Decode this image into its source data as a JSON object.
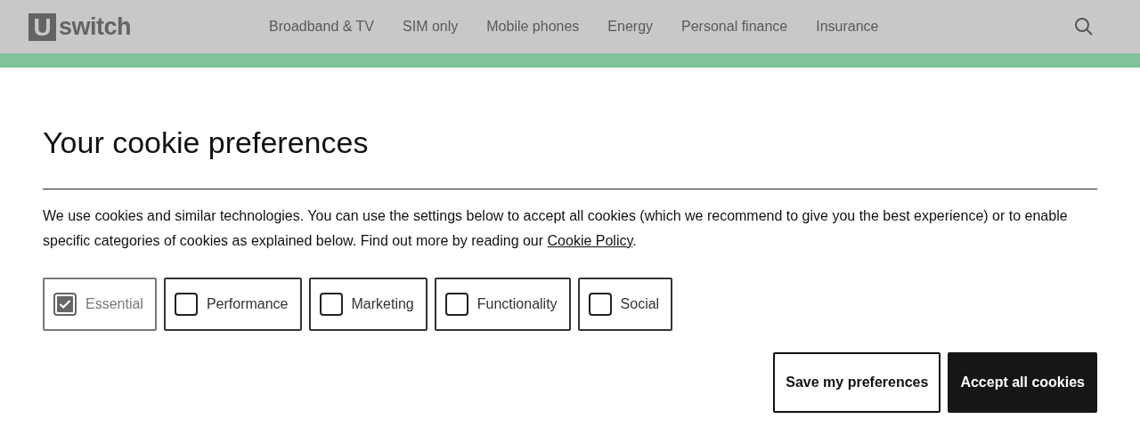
{
  "header": {
    "logo": {
      "mark": "U",
      "text": "switch"
    },
    "nav": [
      "Broadband & TV",
      "SIM only",
      "Mobile phones",
      "Energy",
      "Personal finance",
      "Insurance"
    ]
  },
  "dialog": {
    "title": "Your cookie preferences",
    "intro": "We use cookies and similar technologies. You can use the settings below to accept all cookies (which we recommend to give you the best experience) or to enable specific categories of cookies as explained below. Find out more by reading our ",
    "link": "Cookie Policy",
    "after_link": ".",
    "categories": [
      {
        "label": "Essential",
        "checked": true,
        "disabled": true
      },
      {
        "label": "Performance",
        "checked": false,
        "disabled": false
      },
      {
        "label": "Marketing",
        "checked": false,
        "disabled": false
      },
      {
        "label": "Functionality",
        "checked": false,
        "disabled": false
      },
      {
        "label": "Social",
        "checked": false,
        "disabled": false
      }
    ],
    "buttons": [
      {
        "label": "Save my preferences",
        "kind": "secondary"
      },
      {
        "label": "Accept all cookies",
        "kind": "primary"
      }
    ]
  }
}
